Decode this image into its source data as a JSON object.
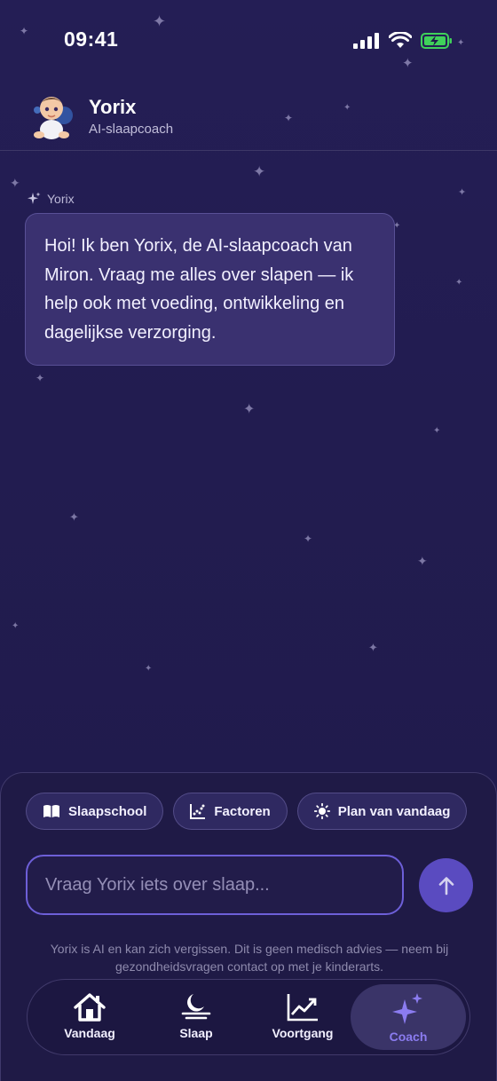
{
  "status_bar": {
    "time": "09:41"
  },
  "header": {
    "name": "Yorix",
    "subtitle": "AI-slaapcoach"
  },
  "chat": {
    "messages": [
      {
        "author": "Yorix",
        "text": "Hoi! Ik ben Yorix, de AI-slaapcoach van Miron. Vraag me alles over slapen — ik help ook met voeding, ontwikkeling en dagelijkse verzorging."
      }
    ]
  },
  "quick_actions": [
    {
      "label": "Slaapschool",
      "icon": "book-icon"
    },
    {
      "label": "Factoren",
      "icon": "scatter-chart-icon"
    },
    {
      "label": "Plan van vandaag",
      "icon": "sun-icon"
    }
  ],
  "input": {
    "placeholder": "Vraag Yorix iets over slaap..."
  },
  "disclaimer": "Yorix is AI en kan zich vergissen. Dit is geen medisch advies — neem bij gezondheidsvragen contact op met je kinderarts.",
  "tabs": [
    {
      "label": "Vandaag",
      "icon": "home-icon",
      "active": false
    },
    {
      "label": "Slaap",
      "icon": "moon-icon",
      "active": false
    },
    {
      "label": "Voortgang",
      "icon": "trend-chart-icon",
      "active": false
    },
    {
      "label": "Coach",
      "icon": "sparkles-icon",
      "active": true
    }
  ],
  "colors": {
    "background": "#231d52",
    "accent": "#8b7cf0",
    "bubble": "#3a3170",
    "send_button": "#5a4bc0",
    "battery": "#3fd15a"
  }
}
